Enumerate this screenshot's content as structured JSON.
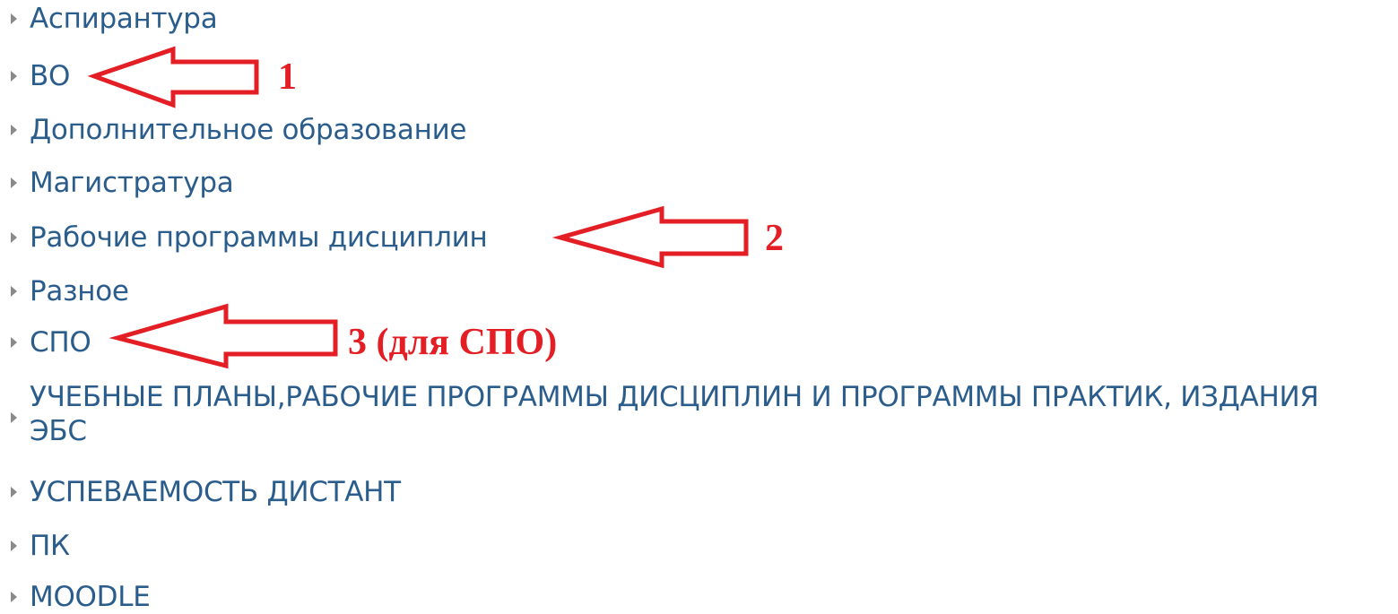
{
  "categories": [
    {
      "label": "Аспирантура"
    },
    {
      "label": "ВО"
    },
    {
      "label": "Дополнительное образование"
    },
    {
      "label": "Магистратура"
    },
    {
      "label": "Рабочие программы дисциплин"
    },
    {
      "label": "Разное"
    },
    {
      "label": "СПО"
    },
    {
      "label": "УЧЕБНЫЕ ПЛАНЫ,РАБОЧИЕ ПРОГРАММЫ ДИСЦИПЛИН И ПРОГРАММЫ ПРАКТИК, ИЗДАНИЯ ЭБС"
    },
    {
      "label": "УСПЕВАЕМОСТЬ ДИСТАНТ"
    },
    {
      "label": "ПК"
    },
    {
      "label": "MOODLE"
    }
  ],
  "annotations": [
    {
      "label": "1"
    },
    {
      "label": "2"
    },
    {
      "label": "3 (для СПО)"
    }
  ],
  "colors": {
    "link": "#2b5d8c",
    "arrow": "#e31e24",
    "triangle": "#8a8a8a"
  }
}
